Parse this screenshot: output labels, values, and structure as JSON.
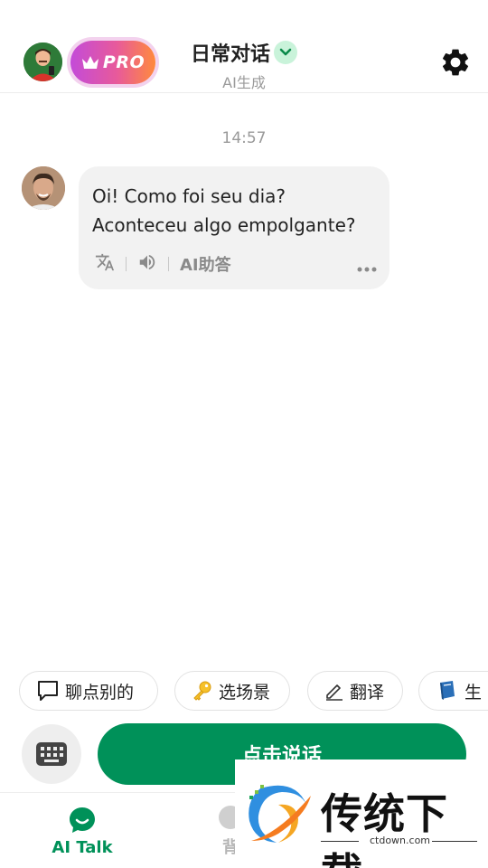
{
  "header": {
    "pro_label": "PRO",
    "title": "日常对话",
    "subtitle": "AI生成"
  },
  "chat": {
    "timestamp": "14:57",
    "messages": [
      {
        "line1": "Oi! Como foi seu dia?",
        "line2": "Aconteceu algo empolgante?",
        "ai_answer_label": "AI助答"
      }
    ]
  },
  "chips": [
    {
      "label": "聊点别的",
      "icon": "speech-bubble-icon"
    },
    {
      "label": "选场景",
      "icon": "key-icon"
    },
    {
      "label": "翻译",
      "icon": "pen-icon"
    },
    {
      "label": "生",
      "icon": "book-icon"
    }
  ],
  "input": {
    "talk_label": "点击说话"
  },
  "nav": {
    "items": [
      {
        "label": "AI Talk",
        "active": true
      },
      {
        "label": "背",
        "active": false
      }
    ]
  },
  "watermark": {
    "text": "传统下载",
    "url": "ctdown.com"
  },
  "colors": {
    "accent": "#009159",
    "pro_gradient_start": "#c34bd9",
    "pro_gradient_end": "#ff8a3d",
    "bubble_bg": "#f2f2f2"
  }
}
